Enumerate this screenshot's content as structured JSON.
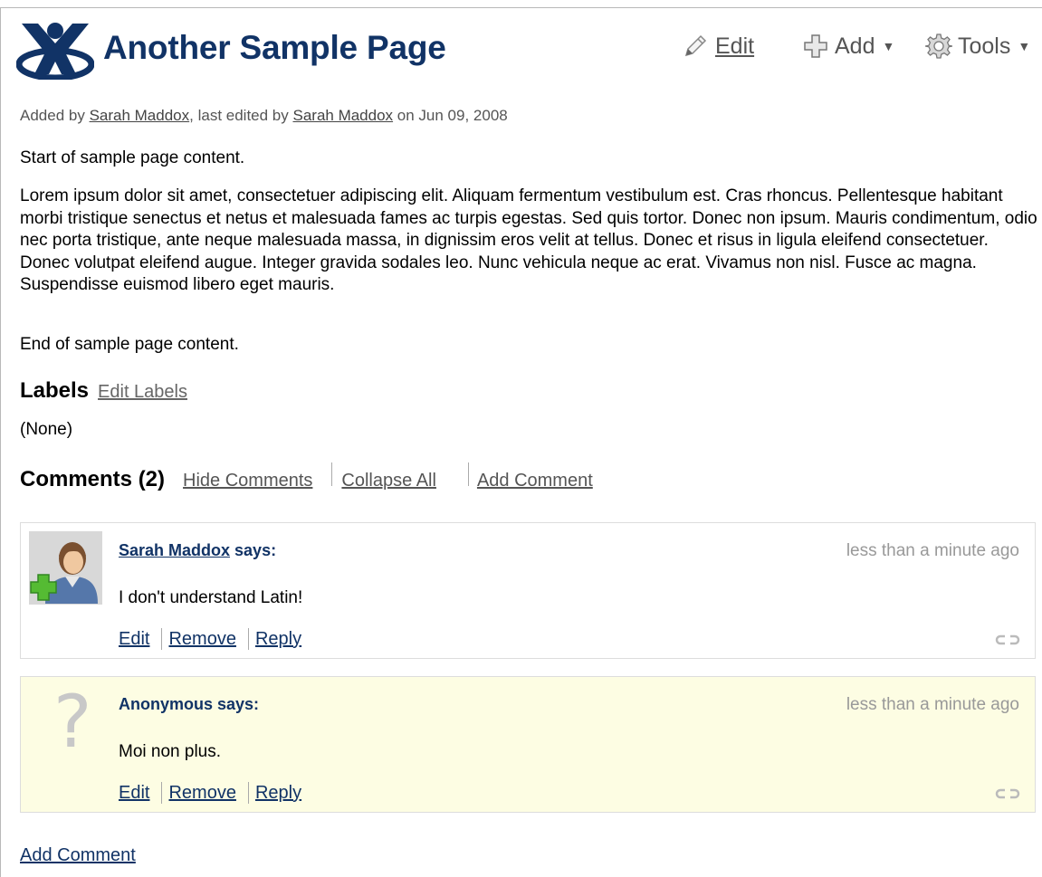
{
  "page": {
    "title": "Another Sample Page"
  },
  "toolbar": {
    "edit_label": "Edit",
    "add_label": "Add",
    "tools_label": "Tools"
  },
  "byline": {
    "prefix": "Added by ",
    "creator": "Sarah Maddox",
    "middle": ", last edited by ",
    "editor": "Sarah Maddox",
    "suffix": " on Jun 09, 2008"
  },
  "content": {
    "intro": "Start of sample page content.",
    "body": "Lorem ipsum dolor sit amet, consectetuer adipiscing elit. Aliquam fermentum vestibulum est. Cras rhoncus. Pellentesque habitant morbi tristique senectus et netus et malesuada fames ac turpis egestas. Sed quis tortor. Donec non ipsum. Mauris condimentum, odio nec porta tristique, ante neque malesuada massa, in dignissim eros velit at tellus. Donec et risus in ligula eleifend consectetuer. Donec volutpat eleifend augue. Integer gravida sodales leo. Nunc vehicula neque ac erat. Vivamus non nisl. Fusce ac magna. Suspendisse euismod libero eget mauris.",
    "outro": "End of sample page content."
  },
  "labels": {
    "heading": "Labels",
    "edit_label": "Edit Labels",
    "value": "(None)"
  },
  "comments": {
    "heading": "Comments (2)",
    "hide": "Hide Comments",
    "collapse": "Collapse All",
    "add": "Add Comment",
    "items": [
      {
        "author": "Sarah Maddox",
        "says": " says:",
        "time": "less than a minute ago",
        "body": "I don't understand Latin!",
        "edit": "Edit",
        "remove": "Remove",
        "reply": "Reply"
      },
      {
        "author": "Anonymous",
        "says": " says:",
        "time": "less than a minute ago",
        "body": "Moi non plus.",
        "edit": "Edit",
        "remove": "Remove",
        "reply": "Reply",
        "avatar_glyph": "?"
      }
    ],
    "add_bottom": "Add Comment"
  },
  "colors": {
    "title": "#113366",
    "anonymous_bg": "#fdfde3"
  }
}
